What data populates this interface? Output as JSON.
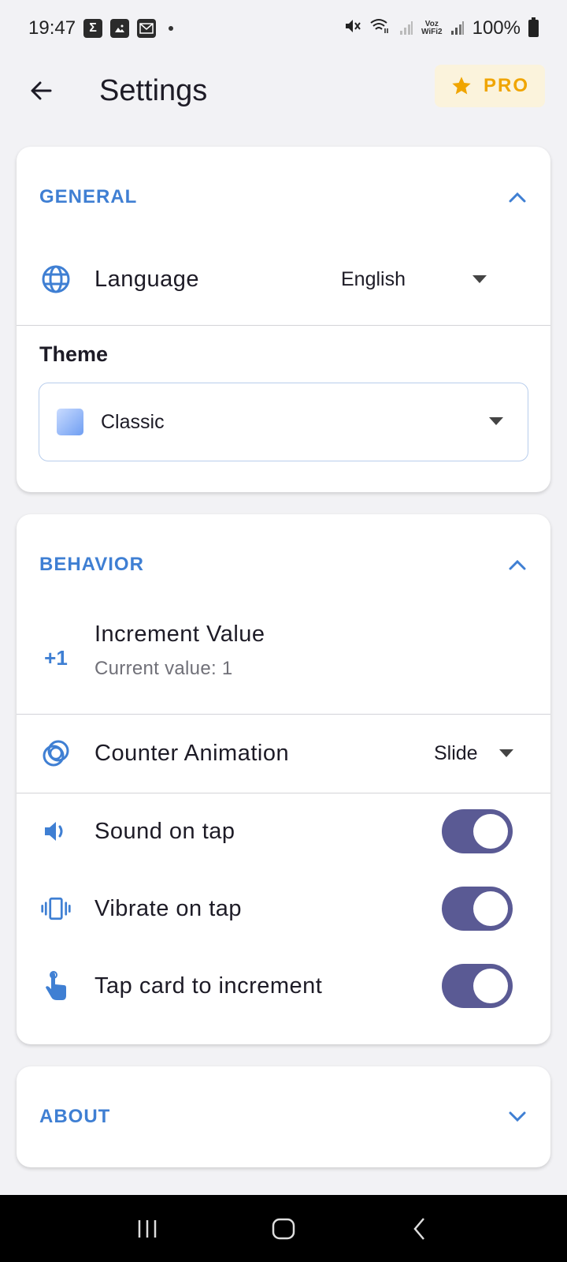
{
  "status_bar": {
    "time": "19:47",
    "notif_icons": [
      "sigma-icon",
      "image-icon",
      "email-icon"
    ],
    "voz_label": "Voz\nWiFi2",
    "battery": "100%"
  },
  "app_bar": {
    "title": "Settings",
    "pro_label": "PRO"
  },
  "general": {
    "title": "GENERAL",
    "language_label": "Language",
    "language_value": "English",
    "theme_label": "Theme",
    "theme_value": "Classic"
  },
  "behavior": {
    "title": "BEHAVIOR",
    "increment_icon_text": "+1",
    "increment_label": "Increment Value",
    "increment_sublabel": "Current value: 1",
    "animation_label": "Counter Animation",
    "animation_value": "Slide",
    "sound_label": "Sound on tap",
    "sound_on": true,
    "vibrate_label": "Vibrate on tap",
    "vibrate_on": true,
    "tap_card_label": "Tap card to increment",
    "tap_card_on": true
  },
  "about": {
    "title": "ABOUT"
  },
  "colors": {
    "accent": "#3f7fd3",
    "toggle_on": "#5a5a94",
    "pro": "#f0a500"
  }
}
